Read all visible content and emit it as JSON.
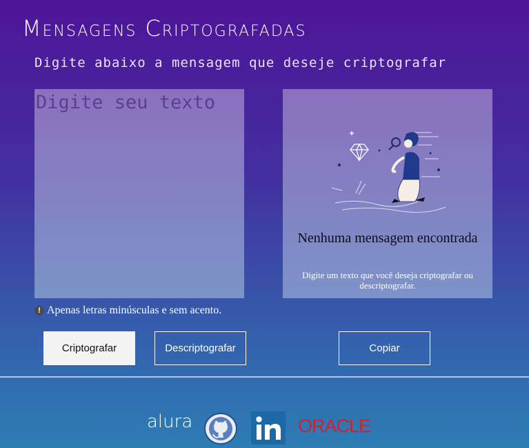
{
  "header": {
    "title": "Mensagens Criptografadas",
    "subtitle": "Digite abaixo a mensagem que deseje criptografar"
  },
  "input": {
    "placeholder": "Digite seu texto",
    "value": ""
  },
  "output": {
    "empty_title": "Nenhuma mensagem encontrada",
    "empty_description": "Digite um texto que você deseja criptografar ou descriptografar."
  },
  "hint": {
    "icon": "!",
    "text": "Apenas letras minúsculas e sem acento."
  },
  "buttons": {
    "encrypt": "Criptografar",
    "decrypt": "Descriptografar",
    "copy": "Copiar"
  },
  "footer": {
    "alura": "alura",
    "oracle": "ORACLE",
    "github_icon": "github-icon",
    "linkedin_icon": "linkedin-icon"
  },
  "colors": {
    "background_top": "#4e1499",
    "background_bottom": "#2d7db4",
    "primary_button": "#f4f4f4",
    "oracle_red": "#d2202f",
    "linkedin_blue": "#1b6aa6"
  }
}
